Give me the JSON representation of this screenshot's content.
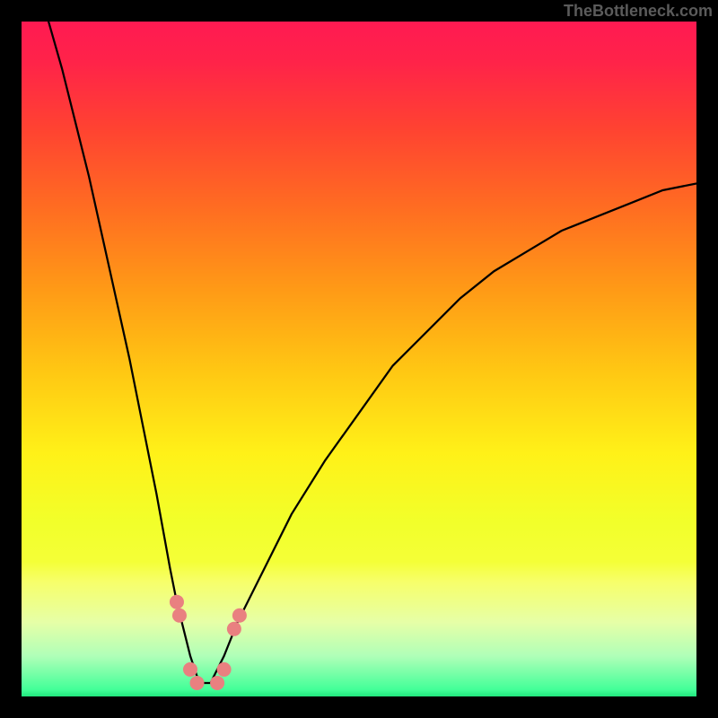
{
  "attribution": "TheBottleneck.com",
  "gradient": {
    "stops": [
      {
        "offset": 0.0,
        "color": "#ff1a52"
      },
      {
        "offset": 0.06,
        "color": "#ff2349"
      },
      {
        "offset": 0.16,
        "color": "#ff4331"
      },
      {
        "offset": 0.28,
        "color": "#ff6e21"
      },
      {
        "offset": 0.4,
        "color": "#ff9b16"
      },
      {
        "offset": 0.52,
        "color": "#ffc813"
      },
      {
        "offset": 0.64,
        "color": "#fff118"
      },
      {
        "offset": 0.74,
        "color": "#f2ff2a"
      },
      {
        "offset": 0.8,
        "color": "#f4ff37"
      },
      {
        "offset": 0.83,
        "color": "#f7ff6a"
      },
      {
        "offset": 0.89,
        "color": "#e6ffa7"
      },
      {
        "offset": 0.94,
        "color": "#b0ffb8"
      },
      {
        "offset": 0.99,
        "color": "#42ff98"
      },
      {
        "offset": 1.0,
        "color": "#21e77d"
      }
    ]
  },
  "chart_data": {
    "type": "line",
    "title": "",
    "xlabel": "",
    "ylabel": "",
    "xlim": [
      0,
      100
    ],
    "ylim": [
      0,
      100
    ],
    "description": "V-shaped bottleneck curve with minimum near x≈27; markers cluster near the bottom of the V.",
    "series": [
      {
        "name": "left-branch",
        "color": "#000000",
        "x": [
          4,
          6,
          8,
          10,
          12,
          14,
          16,
          18,
          20,
          22,
          23,
          24,
          25,
          26,
          27
        ],
        "y": [
          100,
          93,
          85,
          77,
          68,
          59,
          50,
          40,
          30,
          19,
          14,
          10,
          6,
          3,
          2
        ]
      },
      {
        "name": "right-branch",
        "color": "#000000",
        "x": [
          27,
          28,
          29,
          30,
          32,
          35,
          40,
          45,
          50,
          55,
          60,
          65,
          70,
          75,
          80,
          85,
          90,
          95,
          100
        ],
        "y": [
          2,
          2,
          4,
          6,
          11,
          17,
          27,
          35,
          42,
          49,
          54,
          59,
          63,
          66,
          69,
          71,
          73,
          75,
          76
        ]
      }
    ],
    "markers": {
      "name": "bead-markers",
      "color": "#e98080",
      "radius_px": 8,
      "points": [
        {
          "x": 23.0,
          "y": 14
        },
        {
          "x": 23.4,
          "y": 12
        },
        {
          "x": 25.0,
          "y": 4
        },
        {
          "x": 26.0,
          "y": 2
        },
        {
          "x": 29.0,
          "y": 2
        },
        {
          "x": 30.0,
          "y": 4
        },
        {
          "x": 31.5,
          "y": 10
        },
        {
          "x": 32.3,
          "y": 12
        }
      ]
    }
  }
}
